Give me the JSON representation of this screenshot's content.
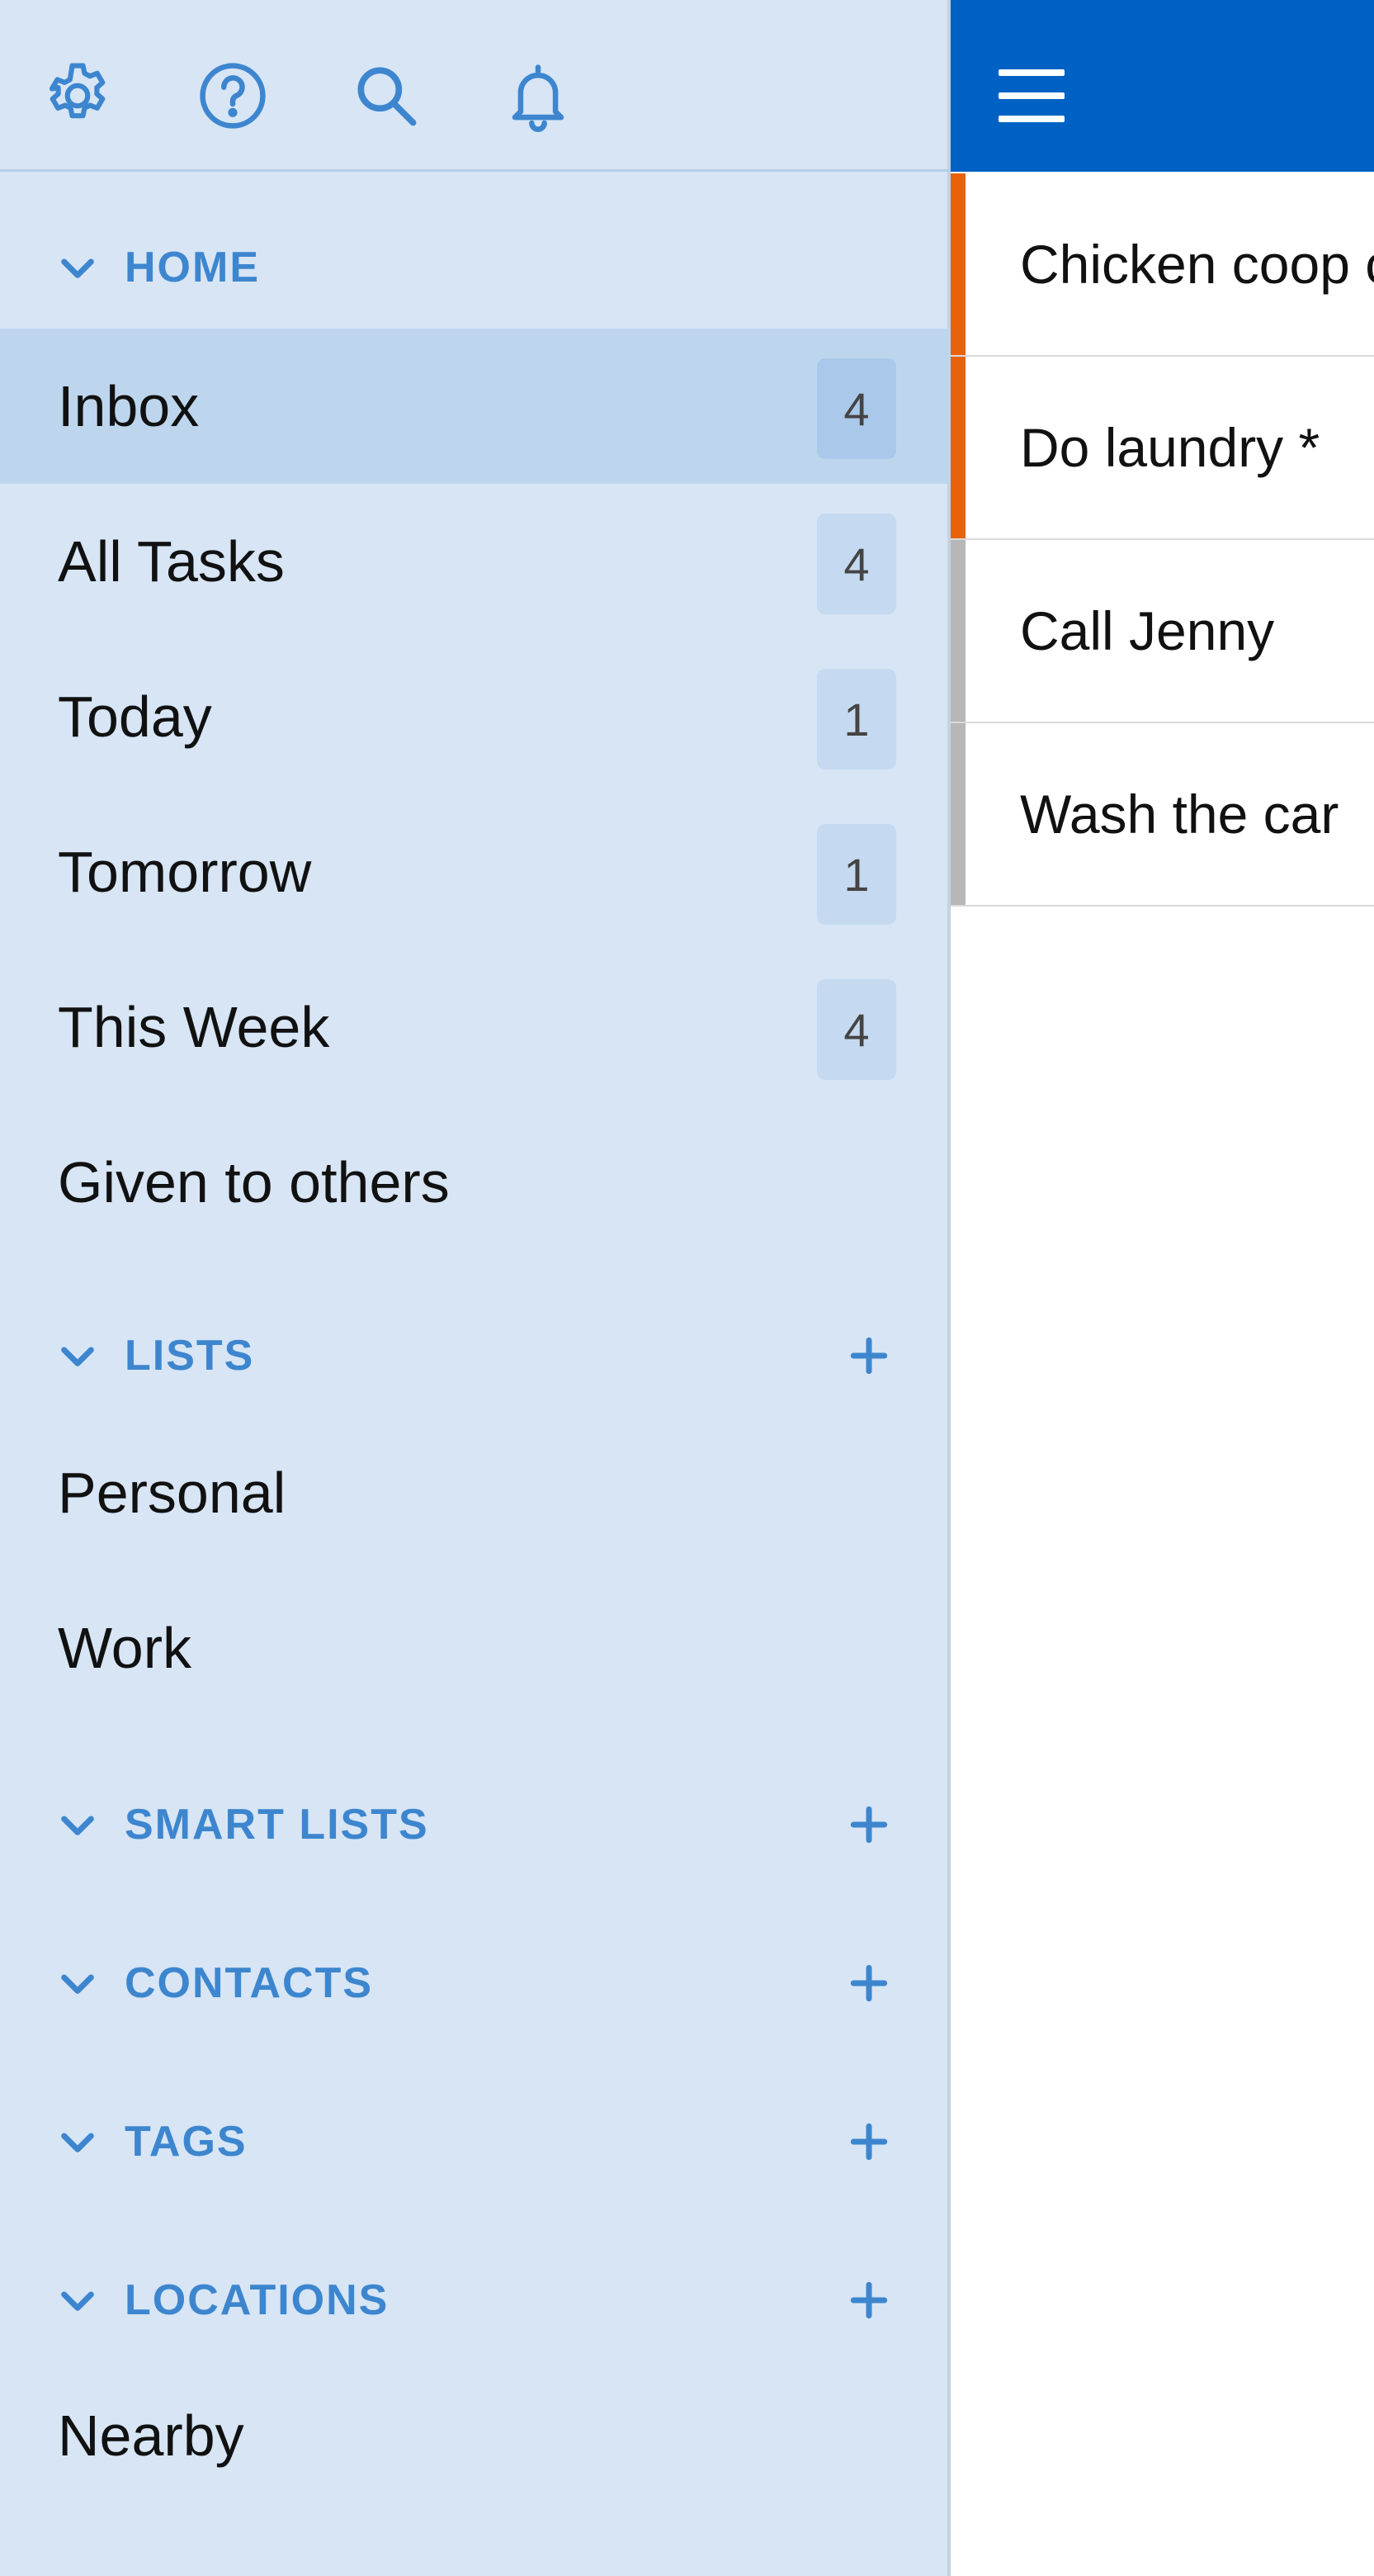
{
  "topbar": {
    "icons": [
      "settings-icon",
      "help-icon",
      "search-icon",
      "bell-icon"
    ]
  },
  "sections": {
    "home": {
      "label": "HOME"
    },
    "lists": {
      "label": "LISTS"
    },
    "smart_lists": {
      "label": "SMART LISTS"
    },
    "contacts": {
      "label": "CONTACTS"
    },
    "tags": {
      "label": "TAGS"
    },
    "locations": {
      "label": "LOCATIONS"
    }
  },
  "home_items": [
    {
      "label": "Inbox",
      "count": "4",
      "selected": true
    },
    {
      "label": "All Tasks",
      "count": "4"
    },
    {
      "label": "Today",
      "count": "1"
    },
    {
      "label": "Tomorrow",
      "count": "1"
    },
    {
      "label": "This Week",
      "count": "4"
    },
    {
      "label": "Given to others"
    }
  ],
  "list_items": [
    {
      "label": "Personal"
    },
    {
      "label": "Work"
    }
  ],
  "location_items": [
    {
      "label": "Nearby"
    }
  ],
  "main": {
    "menu_icon": "hamburger-menu-icon",
    "tasks": [
      {
        "title": "Chicken coop c",
        "priority_color": "#e8620c"
      },
      {
        "title": "Do laundry *",
        "priority_color": "#e8620c"
      },
      {
        "title": "Call Jenny",
        "priority_color": "#b7b7b7"
      },
      {
        "title": "Wash the car",
        "priority_color": "#b7b7b7"
      }
    ]
  },
  "colors": {
    "sidebar_bg": "#d7e5f5",
    "selected_bg": "#bdd6ee",
    "accent": "#3d86cf",
    "header_blue": "#0061c4"
  }
}
